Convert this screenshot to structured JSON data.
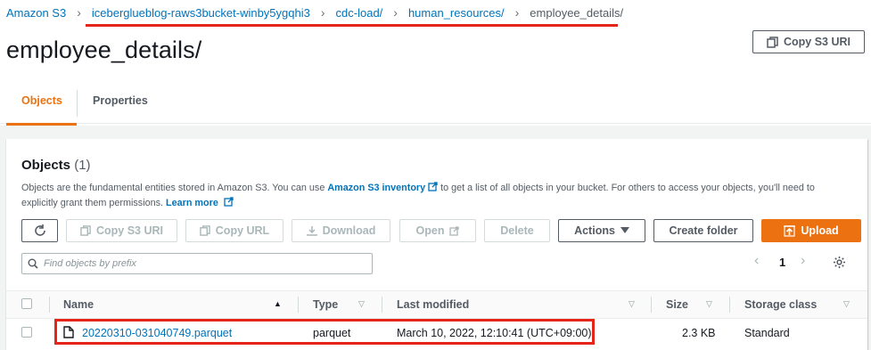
{
  "breadcrumb": {
    "root": "Amazon S3",
    "bucket": "iceberglueblog-raws3bucket-winby5ygqhi3",
    "folder1": "cdc-load/",
    "folder2": "human_resources/",
    "current": "employee_details/"
  },
  "page": {
    "title": "employee_details/",
    "copy_uri_label": "Copy S3 URI"
  },
  "tabs": [
    {
      "label": "Objects",
      "active": true
    },
    {
      "label": "Properties",
      "active": false
    }
  ],
  "objects": {
    "heading": "Objects",
    "count": "(1)",
    "desc_part1": "Objects are the fundamental entities stored in Amazon S3. You can use ",
    "desc_link1": "Amazon S3 inventory",
    "desc_part2": " to get a list of all objects in your bucket. For others to access your objects, you'll need to explicitly grant them permissions. ",
    "desc_link2": "Learn more"
  },
  "toolbar": {
    "copy_s3_uri": "Copy S3 URI",
    "copy_url": "Copy URL",
    "download": "Download",
    "open": "Open",
    "delete": "Delete",
    "actions": "Actions",
    "create_folder": "Create folder",
    "upload": "Upload"
  },
  "search": {
    "placeholder": "Find objects by prefix"
  },
  "pagination": {
    "page": "1"
  },
  "table": {
    "headers": {
      "name": "Name",
      "type": "Type",
      "last_modified": "Last modified",
      "size": "Size",
      "storage_class": "Storage class"
    },
    "rows": [
      {
        "name": "20220310-031040749.parquet",
        "type": "parquet",
        "last_modified": "March 10, 2022, 12:10:41 (UTC+09:00)",
        "size": "2.3 KB",
        "storage_class": "Standard"
      }
    ]
  },
  "colors": {
    "link": "#0073bb",
    "accent": "#ec7211",
    "highlight": "#e5251a"
  }
}
